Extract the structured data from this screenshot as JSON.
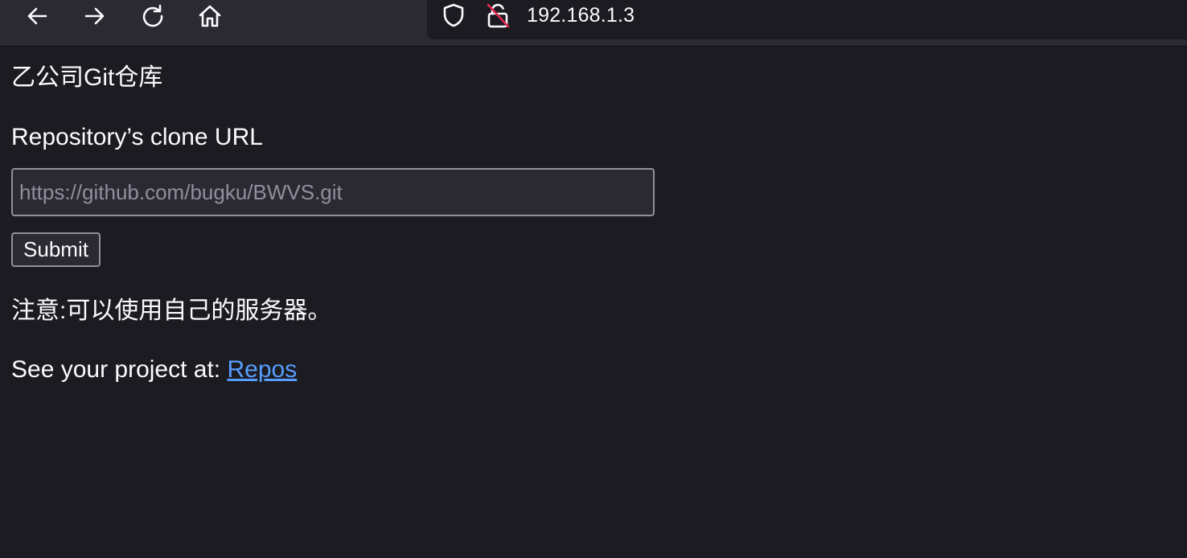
{
  "browser": {
    "nav_icons": [
      "back-arrow-icon",
      "forward-arrow-icon",
      "reload-icon",
      "home-icon"
    ],
    "url_icons": [
      "shield-icon",
      "insecure-lock-icon"
    ],
    "address": "192.168.1.3",
    "colors": {
      "toolbar_bg": "#2b2a33",
      "page_bg": "#1c1b22",
      "text": "#fbfbfe",
      "insecure_slash": "#e22850",
      "link": "#579dfd"
    }
  },
  "page": {
    "company_title": "乙公司Git仓库",
    "clone_label": "Repository’s clone URL",
    "clone_input": {
      "value": "",
      "placeholder": "https://github.com/bugku/BWVS.git"
    },
    "submit_label": "Submit",
    "note": "注意:可以使用自己的服务器。",
    "project_prefix": "See your project at: ",
    "repos_link": "Repos"
  }
}
